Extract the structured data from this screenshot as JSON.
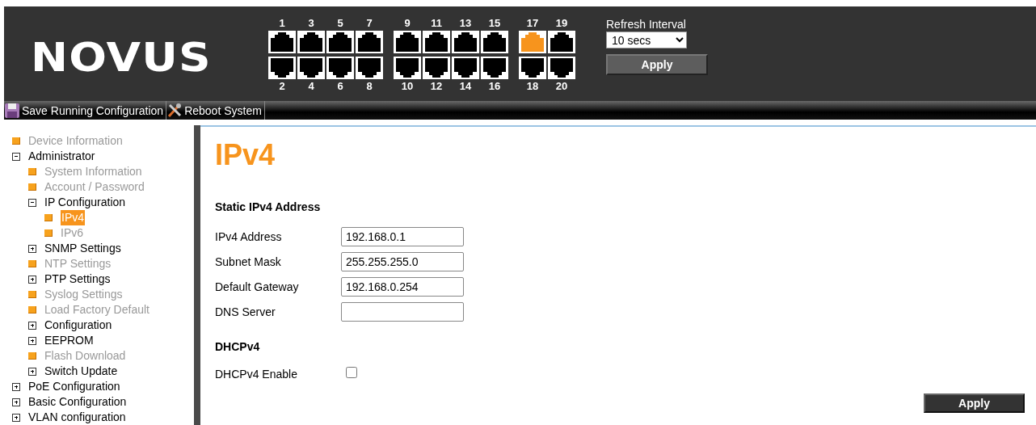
{
  "logo": "NOVUS",
  "ports": [
    {
      "label": "1",
      "active": false
    },
    {
      "label": "2",
      "active": false
    },
    {
      "label": "3",
      "active": false
    },
    {
      "label": "4",
      "active": false
    },
    {
      "label": "5",
      "active": false
    },
    {
      "label": "6",
      "active": false
    },
    {
      "label": "7",
      "active": false
    },
    {
      "label": "8",
      "active": false
    },
    {
      "label": "9",
      "active": false
    },
    {
      "label": "10",
      "active": false
    },
    {
      "label": "11",
      "active": false
    },
    {
      "label": "12",
      "active": false
    },
    {
      "label": "13",
      "active": false
    },
    {
      "label": "14",
      "active": false
    },
    {
      "label": "15",
      "active": false
    },
    {
      "label": "16",
      "active": false
    },
    {
      "label": "17",
      "active": true
    },
    {
      "label": "18",
      "active": false
    },
    {
      "label": "19",
      "active": false
    },
    {
      "label": "20",
      "active": false
    }
  ],
  "refresh": {
    "label": "Refresh Interval",
    "value": "10 secs",
    "button": "Apply"
  },
  "toolbar": [
    {
      "label": "Save Running Configuration",
      "kind": "save"
    },
    {
      "label": "Reboot System",
      "kind": "reboot"
    }
  ],
  "sidebar": [
    {
      "label": "Device Information",
      "kind": "page",
      "selected": false
    },
    {
      "label": "Administrator",
      "kind": "folder",
      "expanded": true,
      "children": [
        {
          "label": "System Information",
          "kind": "page",
          "selected": false
        },
        {
          "label": "Account / Password",
          "kind": "page",
          "selected": false
        },
        {
          "label": "IP Configuration",
          "kind": "folder",
          "expanded": true,
          "children": [
            {
              "label": "IPv4",
              "kind": "page",
              "selected": true
            },
            {
              "label": "IPv6",
              "kind": "page",
              "selected": false
            }
          ]
        },
        {
          "label": "SNMP Settings",
          "kind": "folder",
          "expanded": false
        },
        {
          "label": "NTP Settings",
          "kind": "page",
          "selected": false
        },
        {
          "label": "PTP Settings",
          "kind": "folder",
          "expanded": false
        },
        {
          "label": "Syslog Settings",
          "kind": "page",
          "selected": false
        },
        {
          "label": "Load Factory Default",
          "kind": "page",
          "selected": false
        },
        {
          "label": "Configuration",
          "kind": "folder",
          "expanded": false
        },
        {
          "label": "EEPROM",
          "kind": "folder",
          "expanded": false
        },
        {
          "label": "Flash Download",
          "kind": "page",
          "selected": false
        },
        {
          "label": "Switch Update",
          "kind": "folder",
          "expanded": false
        }
      ]
    },
    {
      "label": "PoE Configuration",
      "kind": "folder",
      "expanded": false
    },
    {
      "label": "Basic Configuration",
      "kind": "folder",
      "expanded": false
    },
    {
      "label": "VLAN configuration",
      "kind": "folder",
      "expanded": false
    }
  ],
  "page": {
    "title": "IPv4",
    "sections": [
      {
        "heading": "Static IPv4 Address",
        "fields": [
          {
            "label": "IPv4 Address",
            "kind": "text",
            "value": "192.168.0.1"
          },
          {
            "label": "Subnet Mask",
            "kind": "text",
            "value": "255.255.255.0"
          },
          {
            "label": "Default Gateway",
            "kind": "text",
            "value": "192.168.0.254"
          },
          {
            "label": "DNS Server",
            "kind": "text"
          }
        ]
      },
      {
        "heading": "DHCPv4",
        "fields": [
          {
            "label": "DHCPv4 Enable",
            "kind": "checkbox",
            "checked": false
          }
        ]
      }
    ],
    "button": "Apply"
  }
}
